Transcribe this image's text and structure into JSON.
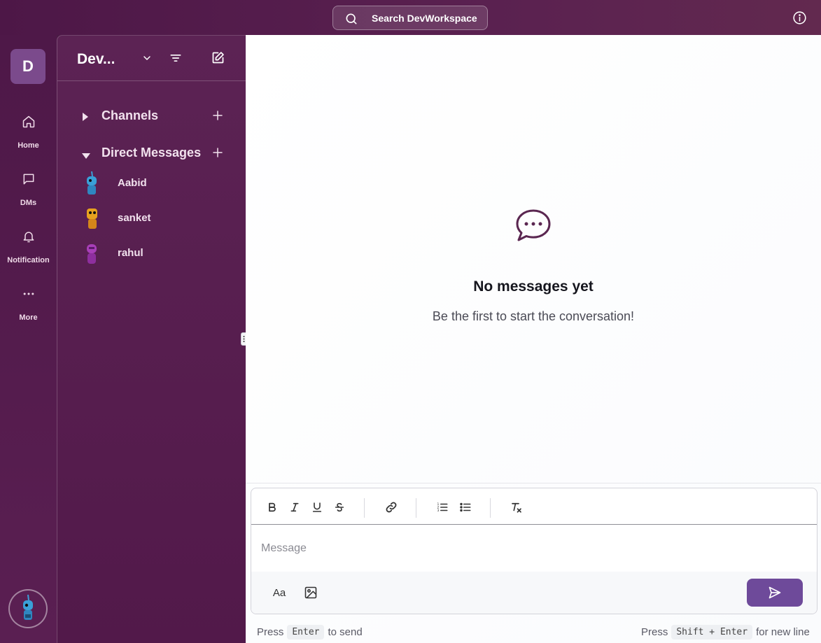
{
  "topbar": {
    "search_label": "Search DevWorkspace"
  },
  "rail": {
    "workspace_initial": "D",
    "items": [
      {
        "label": "Home",
        "icon": "home-icon"
      },
      {
        "label": "DMs",
        "icon": "message-square-icon"
      },
      {
        "label": "Notification",
        "icon": "bell-icon"
      },
      {
        "label": "More",
        "icon": "more-horizontal-icon"
      }
    ]
  },
  "sidebar": {
    "workspace_name": "Dev...",
    "sections": {
      "channels": "Channels",
      "direct_messages": "Direct Messages"
    },
    "dms": [
      {
        "name": "Aabid",
        "avatar_color": "#3aa0d8"
      },
      {
        "name": "sanket",
        "avatar_color": "#e8a21f"
      },
      {
        "name": "rahul",
        "avatar_color": "#a83fb8"
      }
    ]
  },
  "main": {
    "empty_title": "No messages yet",
    "empty_subtitle": "Be the first to start the conversation!"
  },
  "composer": {
    "placeholder": "Message",
    "text_format_label": "Aa",
    "hint_left": {
      "prefix": "Press",
      "key": "Enter",
      "suffix": "to send"
    },
    "hint_right": {
      "prefix": "Press",
      "key": "Shift + Enter",
      "suffix": "for new line"
    }
  },
  "colors": {
    "brand_purple": "#4a1a44",
    "send_button": "#6e4a9a"
  }
}
